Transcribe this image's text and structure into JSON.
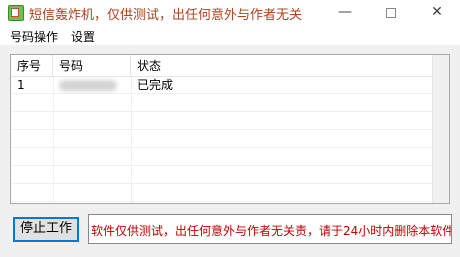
{
  "window": {
    "title": "短信轰炸机，仅供测试，出任何意外与作者无关",
    "minimize_glyph": "—",
    "close_glyph": "✕"
  },
  "menu": {
    "items": [
      "号码操作",
      "设置"
    ]
  },
  "list": {
    "columns": [
      "序号",
      "号码",
      "状态"
    ],
    "rows": [
      {
        "index": "1",
        "number": "",
        "status": "已完成"
      }
    ]
  },
  "actions": {
    "stop_label": "停止工作"
  },
  "status": {
    "text": "软件仅供测试，出任何意外与作者无关责，请于24小时内删除本软件"
  },
  "colors": {
    "title_text": "#b04020",
    "status_text": "#c00000",
    "button_focus": "#0078d7"
  }
}
